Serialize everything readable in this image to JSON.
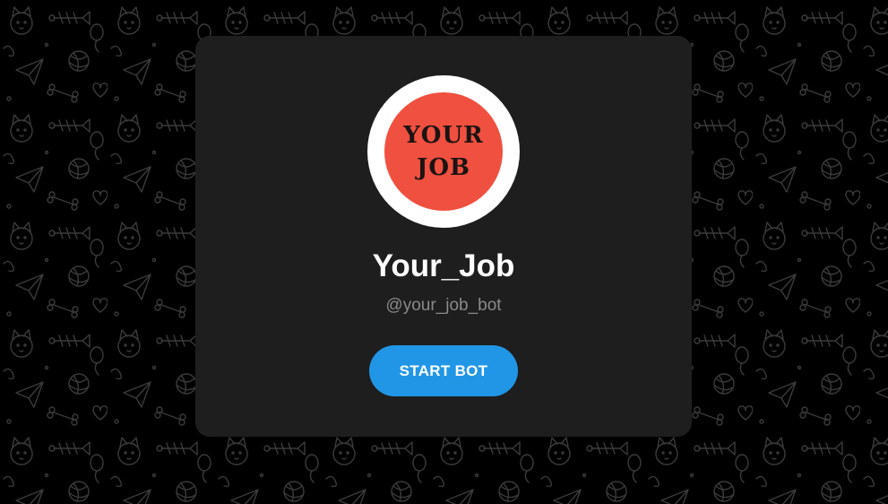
{
  "colors": {
    "background": "#000000",
    "card": "#1e1e1e",
    "accent": "#2196e6",
    "avatar_fill": "#f0503f",
    "doodle_stroke": "#3a3a3a"
  },
  "background": {
    "pattern": "doodle-cats-pattern"
  },
  "bot": {
    "avatar": {
      "line1": "YOUR",
      "line2": "JOB"
    },
    "name": "Your_Job",
    "username": "@your_job_bot"
  },
  "actions": {
    "start_label": "START BOT"
  }
}
